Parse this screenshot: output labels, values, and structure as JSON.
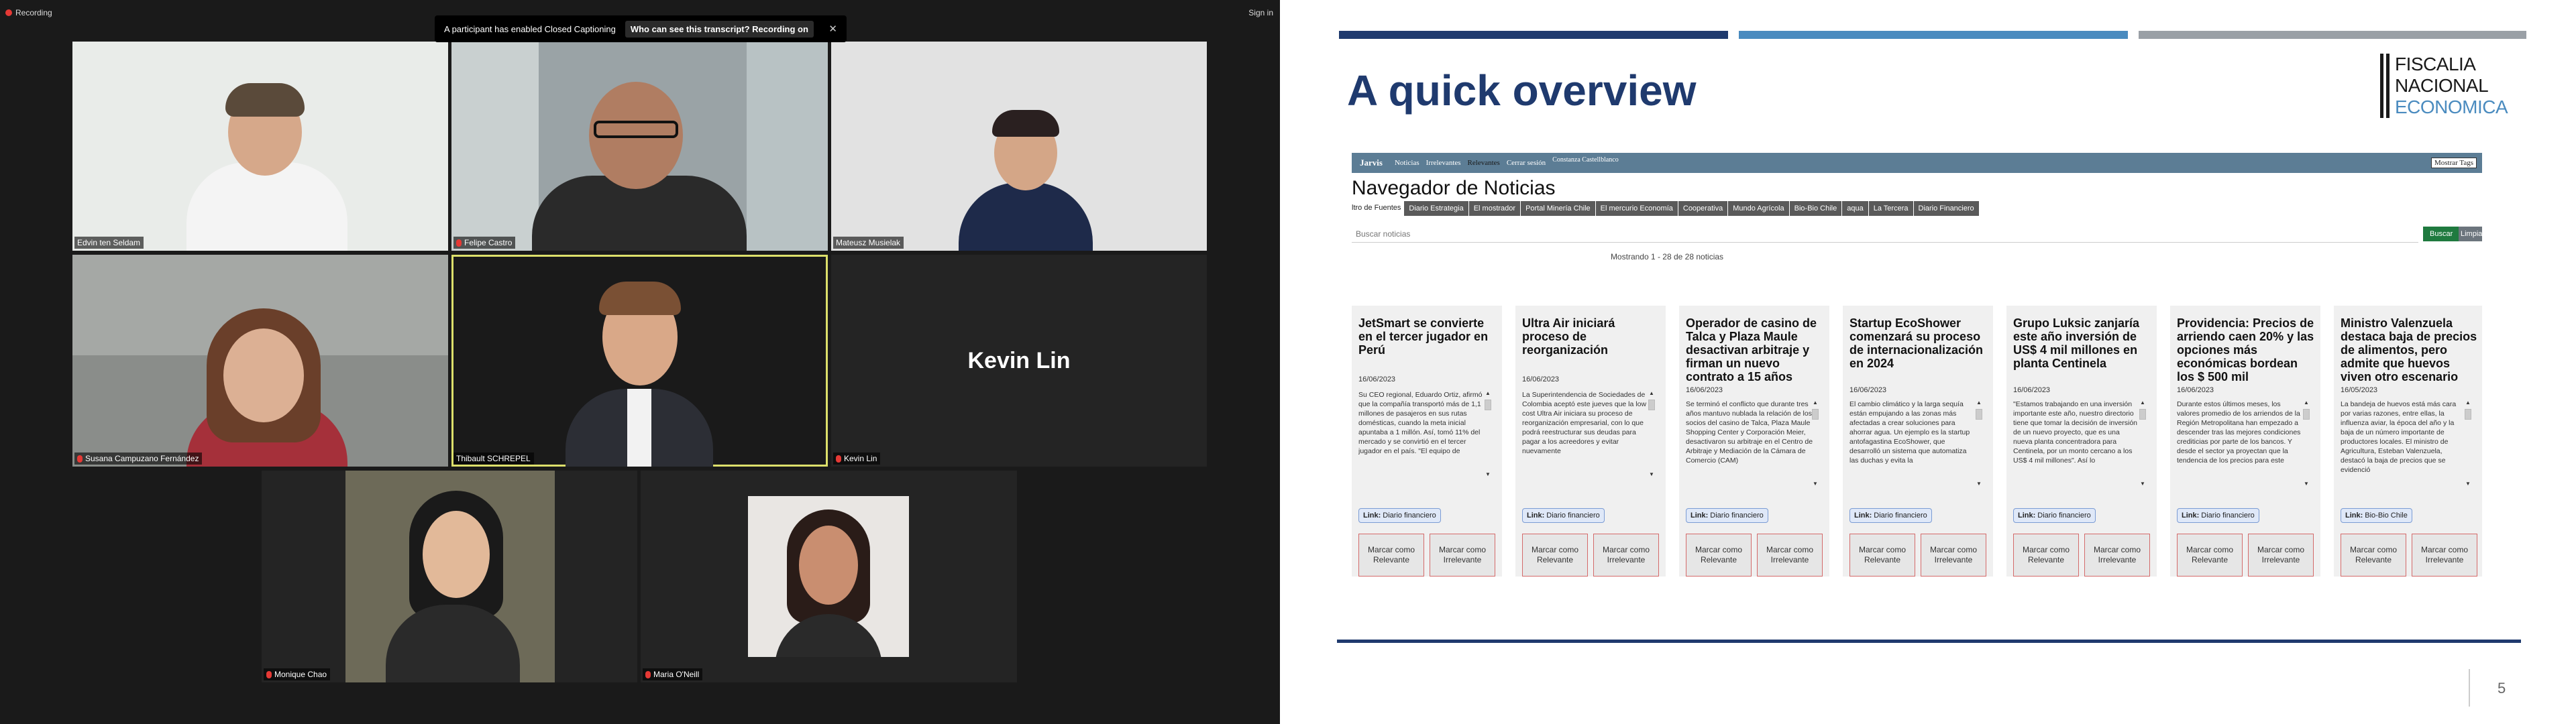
{
  "zoom": {
    "recording_label": "Recording",
    "signin_label": "Sign in",
    "banner": {
      "message": "A participant has enabled Closed Captioning",
      "question": "Who can see this transcript? Recording on",
      "close": "✕"
    },
    "participants": [
      {
        "name": "Edvin ten Seldam",
        "muted": false
      },
      {
        "name": "Felipe Castro",
        "muted": true
      },
      {
        "name": "Mateusz Musielak",
        "muted": false
      },
      {
        "name": "Susana Campuzano Fernández",
        "muted": true
      },
      {
        "name": "Thibault SCHREPEL",
        "muted": false,
        "active": true
      },
      {
        "name": "Kevin Lin",
        "muted": true,
        "video_off": true,
        "display_text": "Kevin Lin"
      },
      {
        "name": "Monique Chao",
        "muted": true
      },
      {
        "name": "Maria O'Neill",
        "muted": true
      }
    ]
  },
  "slide": {
    "title": "A quick overview",
    "logo": {
      "line1": "FISCALIA",
      "line2": "NACIONAL",
      "line3": "ECONOMICA"
    },
    "page_number": "5",
    "stripe_colors": [
      "#1f3a6e",
      "#4a8bbf",
      "#9aa0a6"
    ],
    "app": {
      "brand": "Jarvis",
      "nav_items": [
        "Noticias",
        "Irrelevantes",
        "Relevantes",
        "Cerrar sesión",
        "Constanza Castellblanco"
      ],
      "nav_current_index": 2,
      "tags_button": "Mostrar Tags",
      "page_title": "Navegador de Noticias",
      "filter_label": "ltro de Fuentes",
      "filters": [
        "Diario Estrategia",
        "El mostrador",
        "Portal Minería Chile",
        "El mercurio Economía",
        "Cooperativa",
        "Mundo Agrícola",
        "Bio-Bio Chile",
        "aqua",
        "La Tercera",
        "Diario Financiero"
      ],
      "search_placeholder": "Buscar noticias",
      "search_button": "Buscar",
      "clear_button": "Limpiar",
      "showing": "Mostrando 1 - 28 de 28 noticias",
      "mark_relevant": "Marcar como Relevante",
      "mark_irrelevant": "Marcar como Irrelevante",
      "link_label": "Link:",
      "cards": [
        {
          "title": "JetSmart se convierte en el tercer jugador en Perú",
          "date": "16/06/2023",
          "text": "Su CEO regional, Eduardo Ortiz, afirmó que la compañía transportó más de 1,1 millones de pasajeros en sus rutas domésticas, cuando la meta inicial apuntaba a 1 millón. Así, tomó 11% del mercado y se convirtió en el tercer jugador en el país. \"El equipo de",
          "source": "Diario financiero"
        },
        {
          "title": "Ultra Air iniciará proceso de reorganización",
          "date": "16/06/2023",
          "text": "La Superintendencia de Sociedades de Colombia aceptó este jueves que la low cost Ultra Air iniciara su proceso de reorganización empresarial, con lo que podrá reestructurar sus deudas para pagar a los acreedores y evitar nuevamente",
          "source": "Diario financiero"
        },
        {
          "title": "Operador de casino de Talca y Plaza Maule desactivan arbitraje y firman un nuevo contrato a 15 años",
          "date": "16/06/2023",
          "text": "Se terminó el conflicto que durante tres años mantuvo nublada la relación de los socios del casino de Talca, Plaza Maule Shopping Center y Corporación Meier, desactivaron su arbitraje en el Centro de Arbitraje y Mediación de la Cámara de Comercio (CAM)",
          "source": "Diario financiero"
        },
        {
          "title": "Startup EcoShower comenzará su proceso de internacionalización en 2024",
          "date": "16/06/2023",
          "text": "El cambio climático y la larga sequía están empujando a las zonas más afectadas a crear soluciones para ahorrar agua. Un ejemplo es la startup antofagastina EcoShower, que desarrolló un sistema que automatiza las duchas y evita la",
          "source": "Diario financiero"
        },
        {
          "title": "Grupo Luksic zanjaría este año inversión de US$ 4 mil millones en planta Centinela",
          "date": "16/06/2023",
          "text": "\"Estamos trabajando en una inversión importante este año, nuestro directorio tiene que tomar la decisión de inversión de un nuevo proyecto, que es una nueva planta concentradora para Centinela, por un monto cercano a los US$ 4 mil millones\". Así lo",
          "source": "Diario financiero"
        },
        {
          "title": "Providencia: Precios de arriendo caen 20% y las opciones más económicas bordean los $ 500 mil",
          "date": "16/06/2023",
          "text": "Durante estos últimos meses, los valores promedio de los arriendos de la Región Metropolitana han empezado a descender tras las mejores condiciones crediticias por parte de los bancos. Y desde el sector ya proyectan que la tendencia de los precios para este",
          "source": "Diario financiero"
        },
        {
          "title": "Ministro Valenzuela destaca baja de precios de alimentos, pero admite que huevos viven otro escenario",
          "date": "16/05/2023",
          "text": "La bandeja de huevos está más cara por varias razones, entre ellas, la influenza aviar, la época del año y la baja de un número importante de productores locales. El ministro de Agricultura, Esteban Valenzuela, destacó la baja de precios que se evidenció",
          "source": "Bio-Bio Chile"
        }
      ]
    }
  }
}
